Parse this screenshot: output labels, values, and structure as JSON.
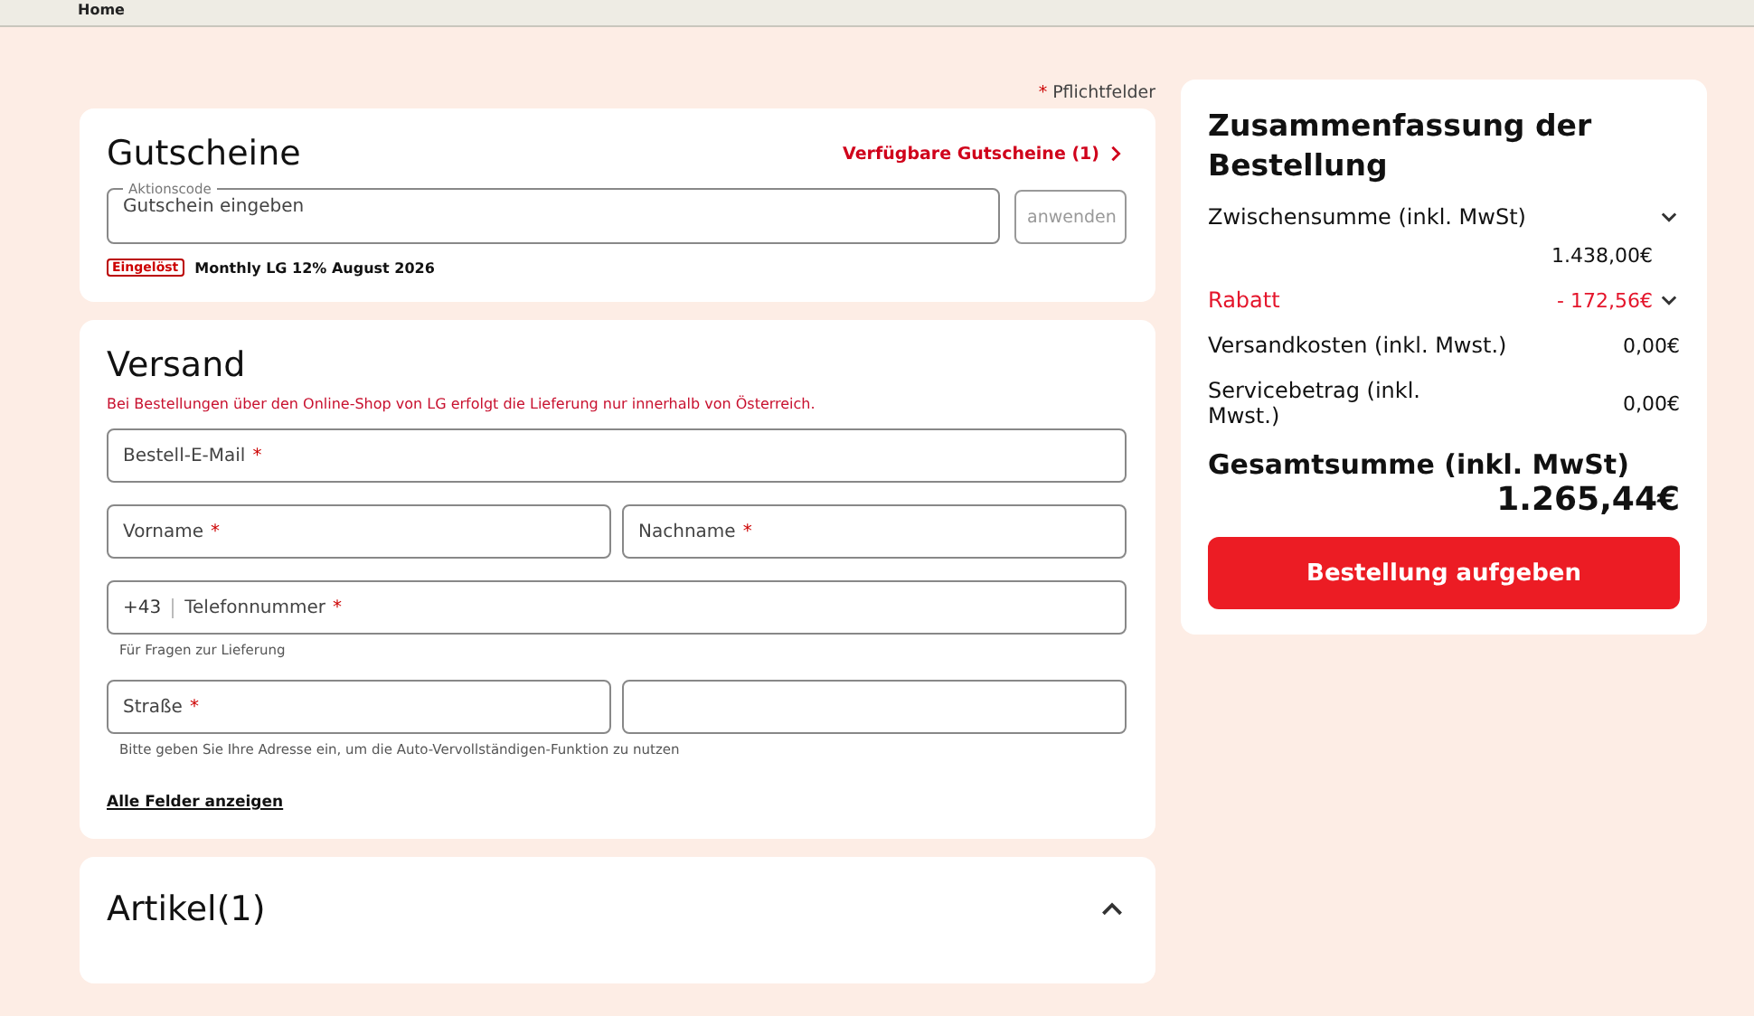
{
  "topbar": {
    "breadcrumb": "Home"
  },
  "required_note": {
    "mark": "*",
    "text": "Pflichtfelder"
  },
  "vouchers": {
    "title": "Gutscheine",
    "available_link": "Verfügbare Gutscheine (1)",
    "field": {
      "label": "Aktionscode",
      "placeholder": "Gutschein eingeben"
    },
    "apply_button": {
      "label": "anwenden",
      "disabled": true
    },
    "redeemed": {
      "badge": "Eingelöst",
      "name": "Monthly LG 12% August 2026"
    }
  },
  "shipping": {
    "title": "Versand",
    "notice": "Bei Bestellungen über den Online-Shop von LG erfolgt die Lieferung nur innerhalb von Österreich.",
    "rows": [
      {
        "fields": [
          {
            "placeholder": "Bestell-E-Mail",
            "required": true
          }
        ]
      },
      {
        "fields": [
          {
            "placeholder": "Vorname",
            "required": true
          },
          {
            "placeholder": "Nachname",
            "required": true
          }
        ]
      },
      {
        "fields": [
          {
            "prefix": "+43",
            "placeholder": "Telefonnummer",
            "required": true
          }
        ],
        "hint": "Für Fragen zur Lieferung"
      },
      {
        "fields": [
          {
            "placeholder": "Straße",
            "required": true
          },
          {
            "required": false
          }
        ],
        "hint": "Bitte geben Sie Ihre Adresse ein, um die Auto-Vervollständigen-Funktion zu nutzen"
      }
    ],
    "show_all_link": "Alle Felder anzeigen"
  },
  "articles": {
    "title": "Artikel(1)",
    "expanded": true
  },
  "summary": {
    "title": "Zusammenfassung der Bestellung",
    "rows": [
      {
        "kind": "stacked",
        "label": "Zwischensumme (inkl. MwSt)",
        "value": "1.438,00€",
        "expanded": false
      },
      {
        "kind": "discount",
        "label": "Rabatt",
        "value": "- 172,56€",
        "expanded": false
      },
      {
        "kind": "plain",
        "label": "Versandkosten (inkl. Mwst.)",
        "value": "0,00€"
      },
      {
        "kind": "plain",
        "label": "Servicebetrag (inkl. Mwst.)",
        "value": "0,00€"
      }
    ],
    "total_label": "Gesamtsumme (inkl. MwSt)",
    "total_value": "1.265,44€",
    "order_button": "Bestellung aufgeben"
  }
}
